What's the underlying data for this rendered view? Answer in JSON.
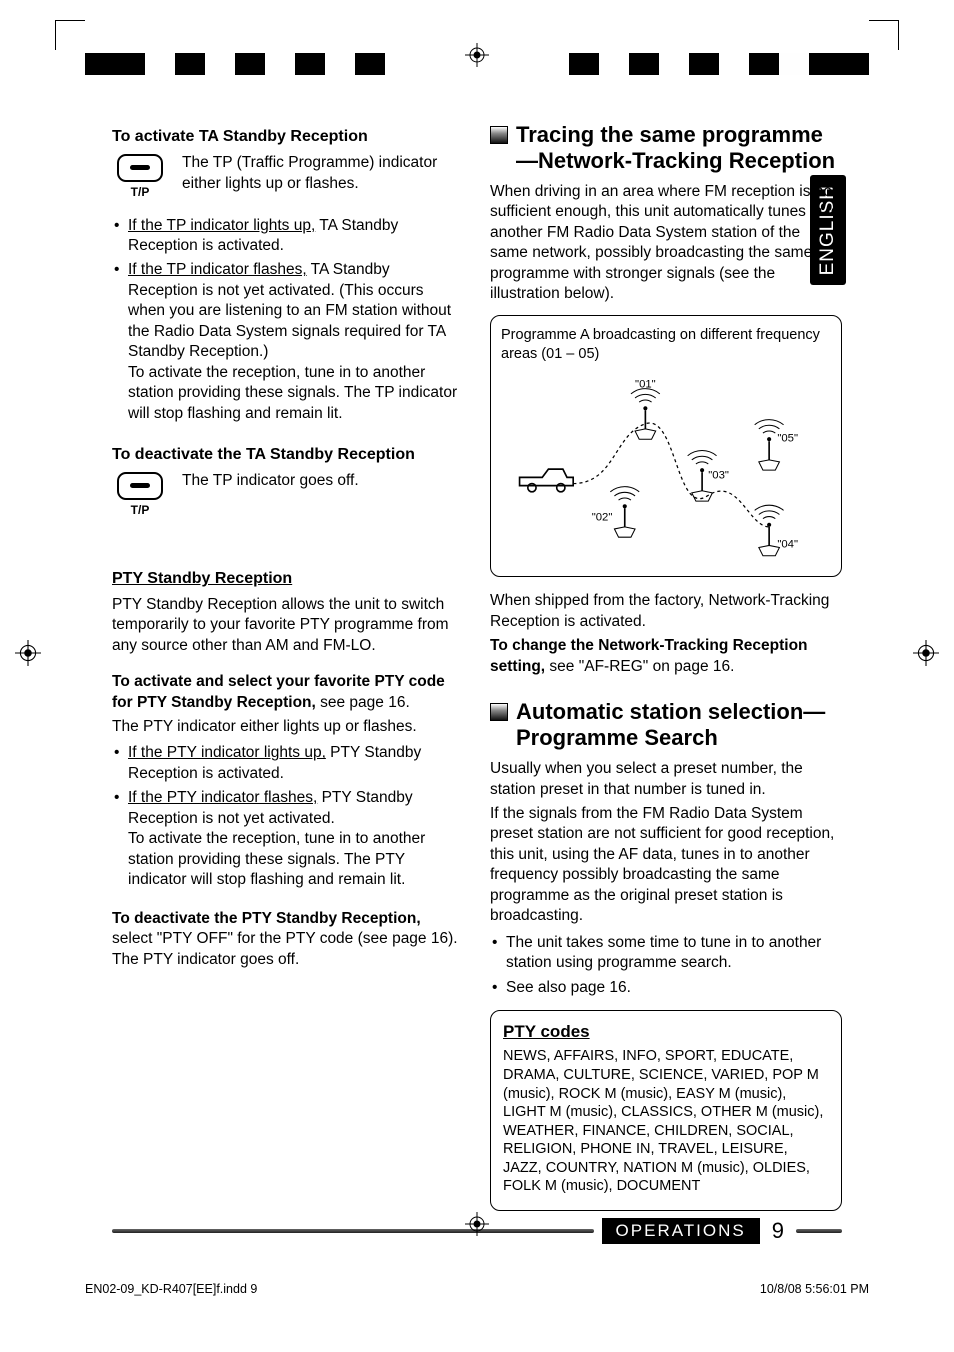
{
  "lang_tab": "ENGLISH",
  "left": {
    "h_activate_ta": "To activate TA Standby Reception",
    "tp_desc_a": "The TP (Traffic Programme) indicator either lights up or flashes.",
    "bul1_pre": "If the TP indicator lights up,",
    "bul1_post": " TA Standby Reception is activated.",
    "bul2_pre": "If the TP indicator flashes,",
    "bul2_post": " TA Standby Reception is not yet activated. (This occurs when you are listening to an FM station without the Radio Data System signals required for TA Standby Reception.)",
    "bul2_extra": "To activate the reception, tune in to another station providing these signals. The TP indicator will stop flashing and remain lit.",
    "h_deactivate_ta": "To deactivate the TA Standby Reception",
    "tp_goes_off": "The TP indicator goes off.",
    "h_pty": "PTY Standby Reception",
    "pty_p1": "PTY Standby Reception allows the unit to switch temporarily to your favorite PTY programme from any source other than AM and FM-LO.",
    "h_pty_activate_a": "To activate and select your favorite PTY code for PTY Standby Reception,",
    "h_pty_activate_b": " see page 16.",
    "pty_ind": "The PTY indicator either lights up or flashes.",
    "pty_bul1_pre": "If the PTY indicator lights up,",
    "pty_bul1_post": " PTY Standby Reception is activated.",
    "pty_bul2_pre": "If the PTY indicator flashes,",
    "pty_bul2_post": " PTY Standby Reception is not yet activated.",
    "pty_bul2_extra": "To activate the reception, tune in to another station providing these signals. The PTY indicator will stop flashing and remain lit.",
    "h_pty_deactivate_a": "To deactivate the PTY Standby Reception,",
    "h_pty_deactivate_b": " select \"PTY OFF\" for the PTY code (see page 16). The PTY indicator goes off."
  },
  "right": {
    "h_tracing": "Tracing the same programme—Network-Tracking Reception",
    "p_tracing": "When driving in an area where FM reception is not sufficient enough, this unit automatically tunes in to another FM Radio Data System station of the same network, possibly broadcasting the same programme with stronger signals (see the illustration below).",
    "diag_caption": "Programme A broadcasting on different frequency areas (01 – 05)",
    "diag_labels": [
      "\"01\"",
      "\"02\"",
      "\"03\"",
      "\"04\"",
      "\"05\""
    ],
    "p_factory": "When shipped from the factory, Network-Tracking Reception is activated.",
    "p_change_a": "To change the Network-Tracking Reception setting,",
    "p_change_b": " see \"AF-REG\" on page 16.",
    "h_auto": "Automatic station selection—Programme Search",
    "p_auto1": "Usually when you select a preset number, the station preset in that number is tuned in.",
    "p_auto2": "If the signals from the FM Radio Data System preset station are not sufficient for good reception, this unit, using the AF data, tunes in to another frequency possibly broadcasting the same programme as the original preset station is broadcasting.",
    "auto_bul1": "The unit takes some time to tune in to another station using programme search.",
    "auto_bul2": "See also page 16.",
    "pty_codes_title": "PTY codes",
    "pty_codes_body": "NEWS, AFFAIRS, INFO, SPORT, EDUCATE, DRAMA, CULTURE, SCIENCE, VARIED, POP M (music), ROCK M (music), EASY M (music), LIGHT M (music), CLASSICS, OTHER M (music), WEATHER, FINANCE, CHILDREN, SOCIAL, RELIGION, PHONE IN, TRAVEL, LEISURE, JAZZ, COUNTRY, NATION M (music), OLDIES, FOLK M (music), DOCUMENT"
  },
  "footer": {
    "section": "OPERATIONS",
    "page": "9",
    "file": "EN02-09_KD-R407[EE]f.indd   9",
    "timestamp": "10/8/08   5:56:01 PM"
  },
  "swatches_left": [
    "#000000",
    "#000000",
    "#ffffff",
    "#000000",
    "#ffffff",
    "#000000",
    "#ffffff",
    "#000000",
    "#ffffff",
    "#000000"
  ],
  "swatches_right": [
    "#000000",
    "#ffffff",
    "#000000",
    "#ffffff",
    "#000000",
    "#ffffff",
    "#000000",
    "#fefefe",
    "#000000",
    "#000000"
  ]
}
